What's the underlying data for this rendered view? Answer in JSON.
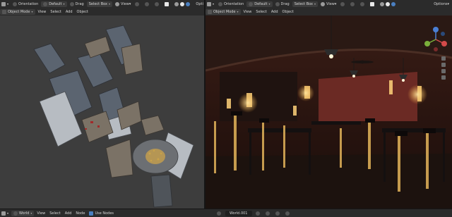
{
  "left_header": {
    "orientation_label": "Orientation",
    "orientation_value": "Default",
    "drag_label": "Drag",
    "drag_value": "Select Box",
    "view_label": "View",
    "options_label": "Opti"
  },
  "left_menu": {
    "mode": "Object Mode",
    "items": [
      "View",
      "Select",
      "Add",
      "Object"
    ]
  },
  "right_header": {
    "orientation_label": "Orientation",
    "orientation_value": "Default",
    "drag_label": "Drag",
    "drag_value": "Select Box",
    "view_label": "View",
    "options_label": "Options"
  },
  "right_menu": {
    "mode": "Object Mode",
    "items": [
      "View",
      "Select",
      "Add",
      "Object"
    ]
  },
  "status_bar": {
    "editor": "World",
    "menu": [
      "View",
      "Select",
      "Add",
      "Node"
    ],
    "use_nodes_label": "Use Nodes",
    "world_name": "World.001"
  },
  "gizmo": {
    "axes": [
      "X",
      "Y",
      "Z"
    ],
    "colors": {
      "x": "#d44a4a",
      "y": "#7aaf3b",
      "z": "#4a7fd4"
    }
  },
  "colors": {
    "header_bg": "#2b2b2b",
    "viewport_left_bg": "#3d3d3d",
    "viewport_right_bg": "#130d0b",
    "accent": "#4a7fc0"
  }
}
